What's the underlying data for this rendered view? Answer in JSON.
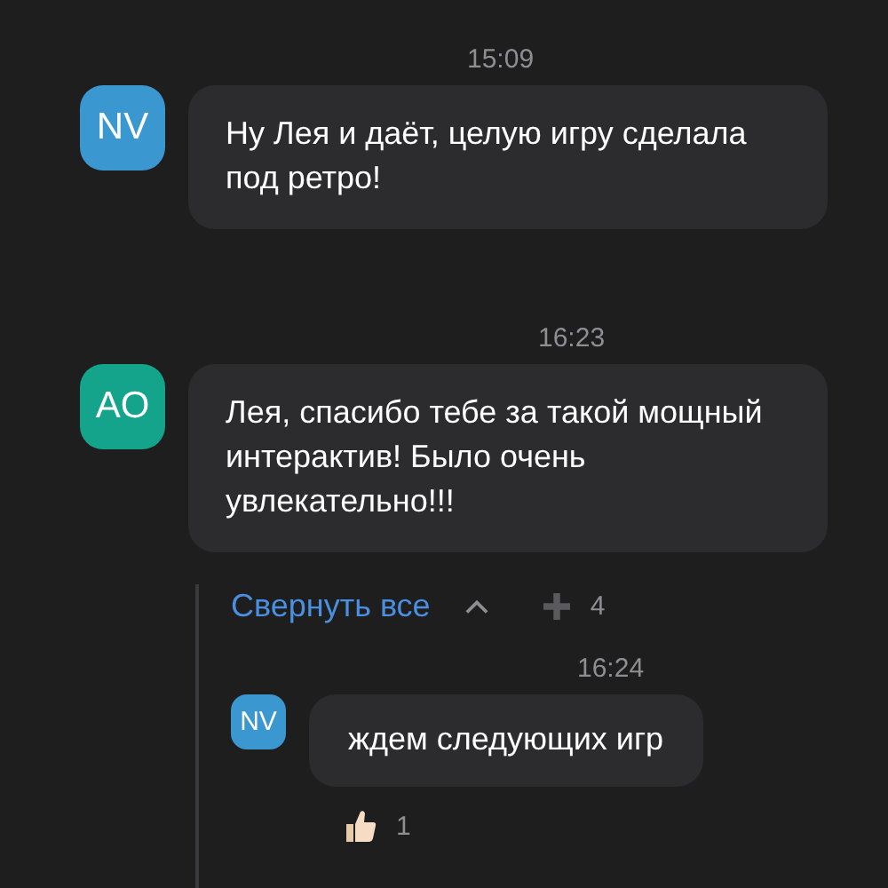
{
  "messages": [
    {
      "time": "15:09",
      "avatar": {
        "initials": "NV",
        "color": "#3a97d0"
      },
      "text": "Ну Лея и даёт, целую игру сделала под ретро!"
    },
    {
      "time": "16:23",
      "avatar": {
        "initials": "AO",
        "color": "#14a38b"
      },
      "text": "Лея, спасибо тебе за такой мощный интерактив! Было очень увлекательно!!!",
      "thread": {
        "collapse_label": "Свернуть все",
        "expanded": true,
        "add_count": "4",
        "replies": [
          {
            "time": "16:24",
            "avatar": {
              "initials": "NV",
              "color": "#3a97d0"
            },
            "text": "ждем следующих игр",
            "reactions": [
              {
                "count": "1"
              }
            ]
          }
        ]
      }
    }
  ]
}
